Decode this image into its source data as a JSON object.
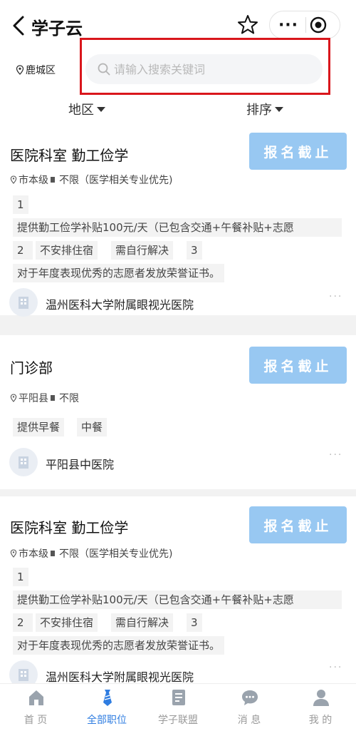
{
  "nav": {
    "title": "学子云",
    "more_label": "···"
  },
  "location": {
    "label": "鹿城区"
  },
  "search": {
    "placeholder": "请输入搜索关键词",
    "value": ""
  },
  "filters": {
    "region_label": "地区",
    "sort_label": "排序"
  },
  "jobs": [
    {
      "title": "医院科室 勤工俭学",
      "apply_label": "报名截止",
      "level": "市本级",
      "requirement": "不限（医学相关专业优先)",
      "tags": [
        "1",
        "提供勤工俭学补贴100元/天（已包含交通+午餐补贴+志愿",
        "2",
        "不安排住宿",
        "需自行解决",
        "3",
        "对于年度表现优秀的志愿者发放荣誉证书。"
      ],
      "org": "温州医科大学附属眼视光医院",
      "more": "···"
    },
    {
      "title": "门诊部",
      "apply_label": "报名截止",
      "level": "平阳县",
      "requirement": "不限",
      "tags": [
        "提供早餐",
        "中餐"
      ],
      "org": "平阳县中医院",
      "more": "···"
    },
    {
      "title": "医院科室 勤工俭学",
      "apply_label": "报名截止",
      "level": "市本级",
      "requirement": "不限（医学相关专业优先)",
      "tags": [
        "1",
        "提供勤工俭学补贴100元/天（已包含交通+午餐补贴+志愿",
        "2",
        "不安排住宿",
        "需自行解决",
        "3",
        "对于年度表现优秀的志愿者发放荣誉证书。"
      ],
      "org": "温州医科大学附属眼视光医院",
      "more": "···"
    }
  ],
  "tabbar": {
    "items": [
      {
        "label": "首 页",
        "icon": "home-icon"
      },
      {
        "label": "全部职位",
        "icon": "tie-icon",
        "active": true
      },
      {
        "label": "学子联盟",
        "icon": "document-icon"
      },
      {
        "label": "消 息",
        "icon": "chat-bubble-icon"
      },
      {
        "label": "我 的",
        "icon": "user-icon"
      }
    ]
  },
  "colors": {
    "accent": "#2f7de1",
    "apply_button": "#98c8f2",
    "highlight_frame": "#d9161c",
    "tab_inactive": "#9a9a9a"
  }
}
